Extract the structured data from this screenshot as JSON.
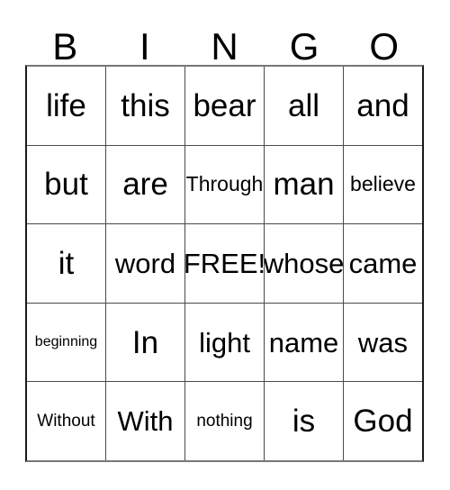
{
  "card": {
    "type": "bingo-card",
    "columns": 5,
    "rows": 5,
    "header": {
      "letters": [
        "B",
        "I",
        "N",
        "G",
        "O"
      ]
    },
    "free_space": {
      "label": "FREE!",
      "row": 3,
      "column": 3
    },
    "grid": [
      [
        {
          "text": "life",
          "size": "lg"
        },
        {
          "text": "this",
          "size": "lg"
        },
        {
          "text": "bear",
          "size": "lg"
        },
        {
          "text": "all",
          "size": "lg"
        },
        {
          "text": "and",
          "size": "lg"
        }
      ],
      [
        {
          "text": "but",
          "size": "lg"
        },
        {
          "text": "are",
          "size": "lg"
        },
        {
          "text": "Through",
          "size": "sm"
        },
        {
          "text": "man",
          "size": "lg"
        },
        {
          "text": "believe",
          "size": "sm"
        }
      ],
      [
        {
          "text": "it",
          "size": "lg"
        },
        {
          "text": "word",
          "size": "md"
        },
        {
          "text": "FREE!",
          "size": "md"
        },
        {
          "text": "whose",
          "size": "md"
        },
        {
          "text": "came",
          "size": "md"
        }
      ],
      [
        {
          "text": "beginning",
          "size": "xxs"
        },
        {
          "text": "In",
          "size": "lg"
        },
        {
          "text": "light",
          "size": "md"
        },
        {
          "text": "name",
          "size": "md"
        },
        {
          "text": "was",
          "size": "md"
        }
      ],
      [
        {
          "text": "Without",
          "size": "xs"
        },
        {
          "text": "With",
          "size": "md"
        },
        {
          "text": "nothing",
          "size": "xs"
        },
        {
          "text": "is",
          "size": "lg"
        },
        {
          "text": "God",
          "size": "lg"
        }
      ]
    ]
  },
  "colors": {
    "background": "#ffffff",
    "text": "#000000",
    "grid_line": "#4a4a4a",
    "grid_border": "#1a1a1a"
  }
}
